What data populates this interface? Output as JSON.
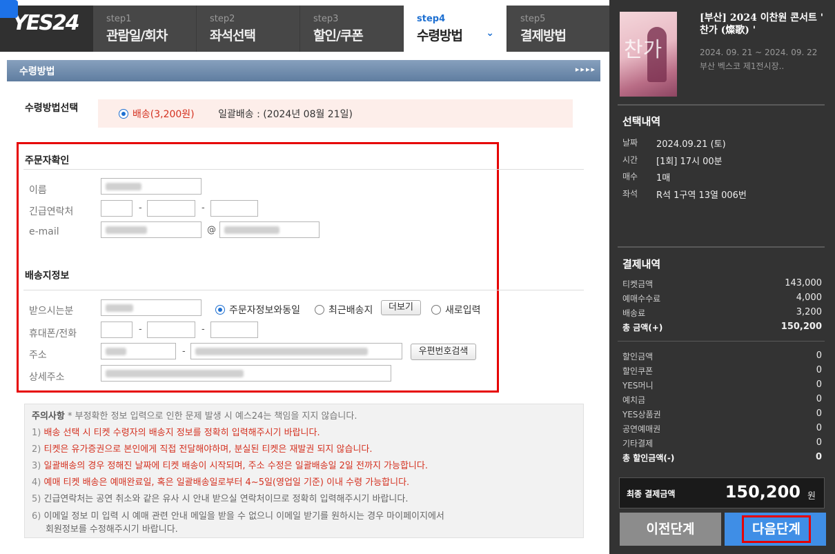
{
  "header": {
    "logo": "YES24",
    "steps": [
      {
        "num": "step1",
        "label": "관람일/회차",
        "active": false
      },
      {
        "num": "step2",
        "label": "좌석선택",
        "active": false
      },
      {
        "num": "step3",
        "label": "할인/쿠폰",
        "active": false
      },
      {
        "num": "step4",
        "label": "수령방법",
        "active": true
      },
      {
        "num": "step5",
        "label": "결제방법",
        "active": false
      }
    ]
  },
  "section": {
    "title": "수령방법",
    "arrows": "▸▸▸▸"
  },
  "method": {
    "label": "수령방법선택",
    "selected": "배송(3,200원)",
    "note": "일괄배송 : (2024년 08월 21일)"
  },
  "orderer": {
    "title": "주문자확인",
    "name_label": "이름",
    "phone_label": "긴급연락처",
    "email_label": "e-mail",
    "dash": "-",
    "at": "@"
  },
  "delivery": {
    "title": "배송지정보",
    "recipient_label": "받으시는분",
    "options": [
      "주문자정보와동일",
      "최근배송지",
      "새로입력"
    ],
    "more_button": "더보기",
    "mobile_label": "휴대폰/전화",
    "address_label": "주소",
    "postcode_button": "우편번호검색",
    "detail_label": "상세주소"
  },
  "notice": {
    "head": "주의사항",
    "head_sub": "* 부정확한 정보 입력으로 인한 문제 발생 시 예스24는 책임을 지지 않습니다.",
    "items": [
      {
        "n": "1)",
        "text": "배송 선택 시 티켓 수령자의 배송지 정보를 정확히 입력해주시기 바랍니다.",
        "red": true
      },
      {
        "n": "2)",
        "text": "티켓은 유가증권으로 본인에게 직접 전달해야하며, 분실된 티켓은 재발권 되지 않습니다.",
        "red": true
      },
      {
        "n": "3)",
        "text": "일괄배송의 경우 정해진 날짜에 티켓 배송이 시작되며, 주소 수정은 일괄배송일 2일 전까지 가능합니다.",
        "red": true
      },
      {
        "n": "4)",
        "text": "예매 티켓 배송은 예매완료일, 혹은 일괄배송일로부터 4~5일(영업일 기준) 이내 수령 가능합니다.",
        "red": true
      },
      {
        "n": "5)",
        "text": "긴급연락처는 공연 취소와 같은 유사 시 안내 받으실 연락처이므로 정확히 입력해주시기 바랍니다.",
        "red": false
      },
      {
        "n": "6)",
        "text": "이메일 정보 미 입력 시 예매 관련 안내 메일을 받을 수 없으니 이메일 받기를 원하시는 경우 마이페이지에서",
        "red": false
      }
    ],
    "item6_cont": "회원정보를 수정해주시기 바랍니다."
  },
  "summary": {
    "show_title": "[부산] 2024 이찬원 콘서트 ' 찬가 (燦歌) '",
    "show_dates": "2024. 09. 21 ~ 2024. 09. 22",
    "show_venue": "부산 벡스코 제1전시장..",
    "poster_text": "찬가",
    "selection_title": "선택내역",
    "selection": [
      {
        "k": "날짜",
        "v": "2024.09.21 (토)"
      },
      {
        "k": "시간",
        "v": "[1회] 17시 00분"
      },
      {
        "k": "매수",
        "v": "1매"
      },
      {
        "k": "좌석",
        "v": "R석 1구역 13열 006번"
      }
    ],
    "payment_title": "결제내역",
    "payment": [
      {
        "k": "티켓금액",
        "v": "143,000"
      },
      {
        "k": "예매수수료",
        "v": "4,000"
      },
      {
        "k": "배송료",
        "v": "3,200"
      },
      {
        "k": "총 금액(+)",
        "v": "150,200"
      }
    ],
    "discount": [
      {
        "k": "할인금액",
        "v": "0"
      },
      {
        "k": "할인쿠폰",
        "v": "0"
      },
      {
        "k": "YES머니",
        "v": "0"
      },
      {
        "k": "예치금",
        "v": "0"
      },
      {
        "k": "YES상품권",
        "v": "0"
      },
      {
        "k": "공연예매권",
        "v": "0"
      },
      {
        "k": "기타결제",
        "v": "0"
      },
      {
        "k": "총 할인금액(-)",
        "v": "0"
      }
    ],
    "final_label": "최종 결제금액",
    "final_value": "150,200",
    "final_unit": "원",
    "prev_button": "이전단계",
    "next_button": "다음단계"
  }
}
